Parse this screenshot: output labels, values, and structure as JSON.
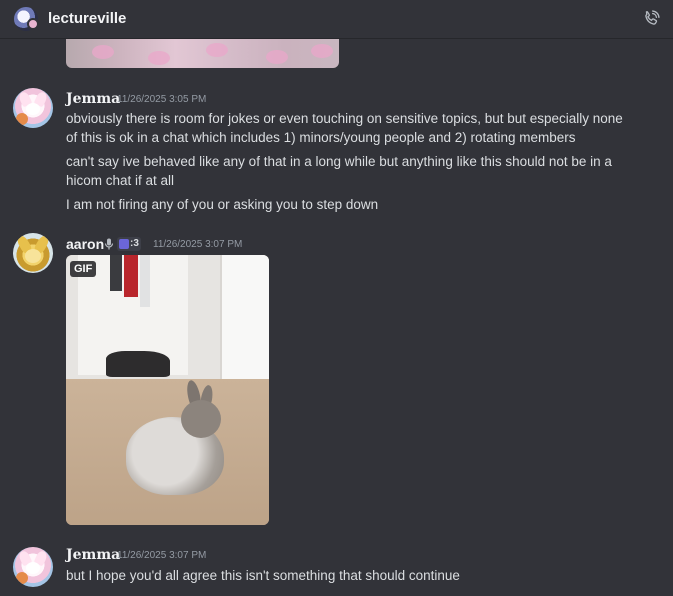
{
  "header": {
    "server_name": "lectureville",
    "server_icon": "server-avatar-icon",
    "call_icon": "phone-call-icon"
  },
  "messages": [
    {
      "author": "Jemma",
      "timestamp": "11/26/2025 3:05 PM",
      "lines": [
        "obviously there is room for jokes or even touching on sensitive topics, but but especially none",
        "of this is ok in a chat which includes 1) minors/young people and 2) rotating members",
        "can't say ive behaved like any of that in a long while but anything like this should not be in a",
        "hicom chat if at all",
        "I am not firing any of you or asking you to step down"
      ]
    },
    {
      "author": "aaron",
      "timestamp": "11/26/2025 3:07 PM",
      "tag": ":3",
      "attachment_badge": "GIF"
    },
    {
      "author": "Jemma",
      "timestamp": "11/26/2025 3:07 PM",
      "lines": [
        "but I hope you'd all agree this isn't something that should continue"
      ]
    }
  ],
  "colors": {
    "background": "#323339",
    "text": "#dbdee1",
    "muted": "#949ba4",
    "username": "#f2f3f5"
  }
}
